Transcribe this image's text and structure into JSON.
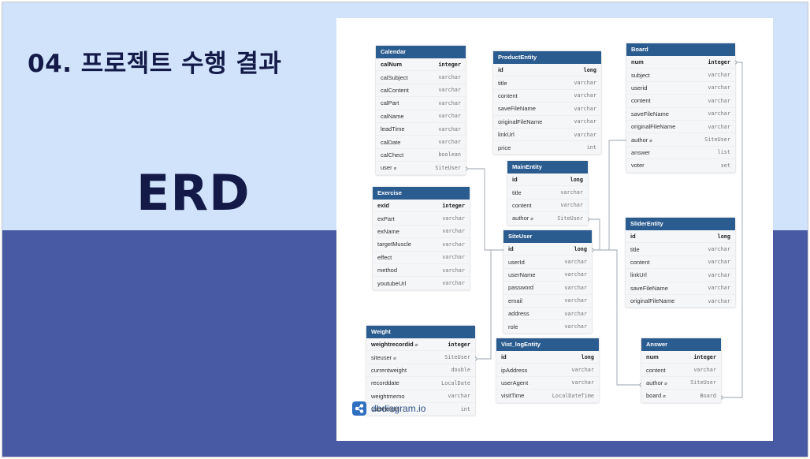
{
  "slide": {
    "title": "04. 프로젝트 수행 결과",
    "subtitle": "ERD"
  },
  "colors": {
    "top_band": "#d1e3fb",
    "bottom_band": "#475aa3",
    "title_text": "#131a47",
    "table_header": "#2b5c8f"
  },
  "brand": {
    "name": "dbdiagram.io",
    "icon": "share-nodes-icon"
  },
  "tables": {
    "calendar": {
      "name": "Calendar",
      "columns": [
        {
          "name": "calNum",
          "type": "integer",
          "pk": true
        },
        {
          "name": "calSubject",
          "type": "varchar"
        },
        {
          "name": "calContent",
          "type": "varchar"
        },
        {
          "name": "calPart",
          "type": "varchar"
        },
        {
          "name": "calName",
          "type": "varchar"
        },
        {
          "name": "leadTime",
          "type": "varchar"
        },
        {
          "name": "calDate",
          "type": "varchar"
        },
        {
          "name": "calChect",
          "type": "boolean"
        },
        {
          "name": "user",
          "type": "SiteUser",
          "fk": true
        }
      ]
    },
    "product": {
      "name": "ProductEntity",
      "columns": [
        {
          "name": "id",
          "type": "long",
          "pk": true
        },
        {
          "name": "title",
          "type": "varchar"
        },
        {
          "name": "content",
          "type": "varchar"
        },
        {
          "name": "saveFileName",
          "type": "varchar"
        },
        {
          "name": "originalFileName",
          "type": "varchar"
        },
        {
          "name": "linkUrl",
          "type": "varchar"
        },
        {
          "name": "price",
          "type": "int"
        }
      ]
    },
    "board": {
      "name": "Board",
      "columns": [
        {
          "name": "num",
          "type": "integer",
          "pk": true
        },
        {
          "name": "subject",
          "type": "varchar"
        },
        {
          "name": "userid",
          "type": "varchar"
        },
        {
          "name": "content",
          "type": "varchar"
        },
        {
          "name": "saveFileName",
          "type": "varchar"
        },
        {
          "name": "originalFileName",
          "type": "varchar"
        },
        {
          "name": "author",
          "type": "SiteUser",
          "fk": true
        },
        {
          "name": "answer",
          "type": "list"
        },
        {
          "name": "voter",
          "type": "set"
        }
      ]
    },
    "main": {
      "name": "MainEntity",
      "columns": [
        {
          "name": "id",
          "type": "long",
          "pk": true
        },
        {
          "name": "title",
          "type": "varchar"
        },
        {
          "name": "content",
          "type": "varchar"
        },
        {
          "name": "author",
          "type": "SiteUser",
          "fk": true
        }
      ]
    },
    "exercise": {
      "name": "Exercise",
      "columns": [
        {
          "name": "exId",
          "type": "integer",
          "pk": true
        },
        {
          "name": "exPart",
          "type": "varchar"
        },
        {
          "name": "exName",
          "type": "varchar"
        },
        {
          "name": "targetMuscle",
          "type": "varchar"
        },
        {
          "name": "effect",
          "type": "varchar"
        },
        {
          "name": "method",
          "type": "varchar"
        },
        {
          "name": "youtubeUrl",
          "type": "varchar"
        }
      ]
    },
    "siteuser": {
      "name": "SiteUser",
      "columns": [
        {
          "name": "id",
          "type": "long",
          "pk": true
        },
        {
          "name": "userId",
          "type": "varchar"
        },
        {
          "name": "userName",
          "type": "varchar"
        },
        {
          "name": "password",
          "type": "varchar"
        },
        {
          "name": "email",
          "type": "varchar"
        },
        {
          "name": "address",
          "type": "varchar"
        },
        {
          "name": "role",
          "type": "varchar"
        }
      ]
    },
    "slider": {
      "name": "SliderEntity",
      "columns": [
        {
          "name": "id",
          "type": "long",
          "pk": true
        },
        {
          "name": "title",
          "type": "varchar"
        },
        {
          "name": "content",
          "type": "varchar"
        },
        {
          "name": "linkUrl",
          "type": "varchar"
        },
        {
          "name": "saveFileName",
          "type": "varchar"
        },
        {
          "name": "originalFileName",
          "type": "varchar"
        }
      ]
    },
    "weight": {
      "name": "Weight",
      "columns": [
        {
          "name": "weightrecordid",
          "type": "integer",
          "pk": true,
          "fk": true
        },
        {
          "name": "siteuser",
          "type": "SiteUser",
          "fk": true
        },
        {
          "name": "currentweight",
          "type": "double"
        },
        {
          "name": "recorddate",
          "type": "LocalDate"
        },
        {
          "name": "weightmemo",
          "type": "varchar"
        },
        {
          "name": "userheight",
          "type": "int"
        }
      ]
    },
    "visit": {
      "name": "Vist_logEntity",
      "columns": [
        {
          "name": "id",
          "type": "long",
          "pk": true
        },
        {
          "name": "ipAddress",
          "type": "varchar"
        },
        {
          "name": "userAgent",
          "type": "varchar"
        },
        {
          "name": "visitTime",
          "type": "LocalDateTime"
        }
      ]
    },
    "answer": {
      "name": "Answer",
      "columns": [
        {
          "name": "num",
          "type": "integer",
          "pk": true
        },
        {
          "name": "content",
          "type": "varchar"
        },
        {
          "name": "author",
          "type": "SiteUser",
          "fk": true
        },
        {
          "name": "board",
          "type": "Board",
          "fk": true
        }
      ]
    }
  }
}
